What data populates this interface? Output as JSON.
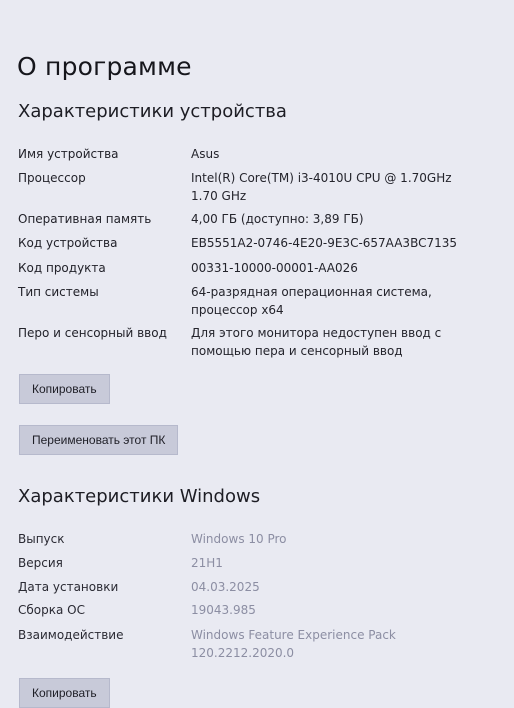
{
  "page_title": "О программе",
  "device_section": {
    "title": "Характеристики устройства",
    "rows": [
      {
        "label": "Имя устройства",
        "value": "Asus"
      },
      {
        "label": "Процессор",
        "value": "Intel(R) Core(TM) i3-4010U CPU @ 1.70GHz 1.70 GHz"
      },
      {
        "label": "Оперативная память",
        "value": "4,00 ГБ (доступно: 3,89 ГБ)"
      },
      {
        "label": "Код устройства",
        "value": "EB5551A2-0746-4E20-9E3C-657AA3BC7135"
      },
      {
        "label": "Код продукта",
        "value": "00331-10000-00001-AA026"
      },
      {
        "label": "Тип системы",
        "value": "64-разрядная операционная система, процессор x64"
      },
      {
        "label": "Перо и сенсорный ввод",
        "value": "Для этого монитора недоступен ввод с помощью пера и сенсорный ввод"
      }
    ],
    "copy_button": "Копировать",
    "rename_button": "Переименовать этот ПК"
  },
  "windows_section": {
    "title": "Характеристики Windows",
    "rows": [
      {
        "label": "Выпуск",
        "value": "Windows 10 Pro"
      },
      {
        "label": "Версия",
        "value": "21H1"
      },
      {
        "label": "Дата установки",
        "value": "04.03.2025"
      },
      {
        "label": "Сборка ОС",
        "value": "19043.985"
      },
      {
        "label": "Взаимодействие",
        "value": "Windows Feature Experience Pack 120.2212.2020.0"
      }
    ],
    "copy_button": "Копировать"
  },
  "colors": {
    "background": "#e9eaf2",
    "button": "#c8cad9",
    "muted_value": "#8c8ea3"
  }
}
